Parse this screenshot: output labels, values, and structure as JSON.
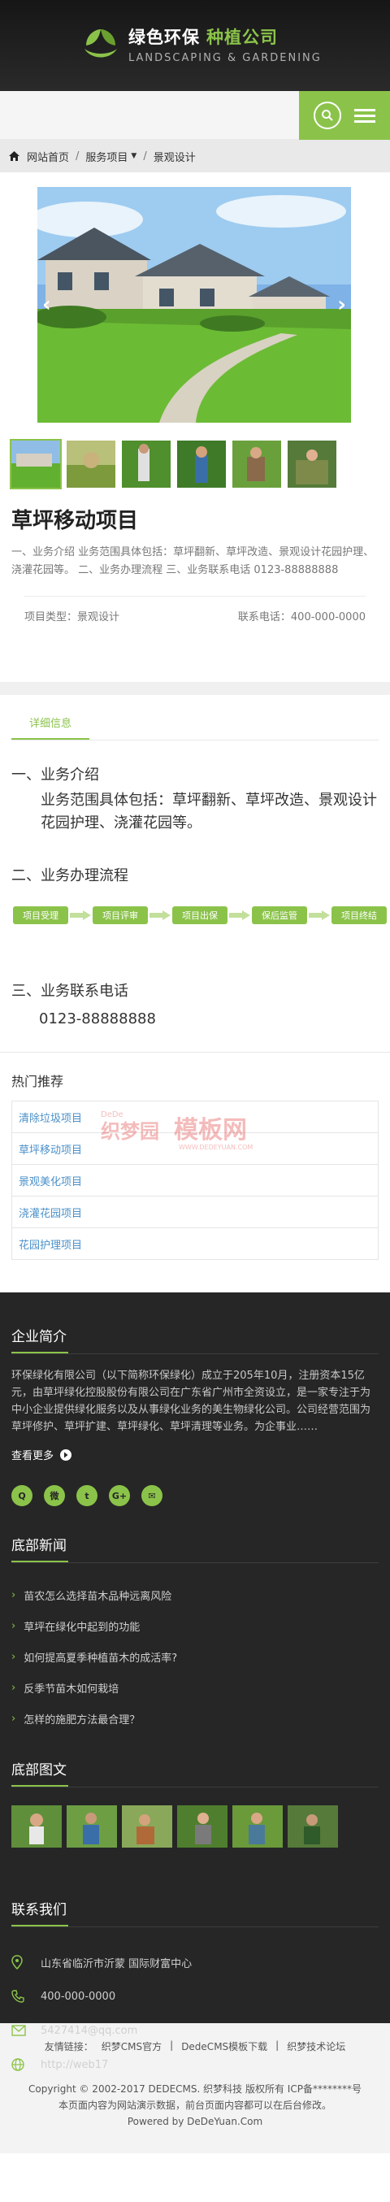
{
  "header": {
    "logo_cn_main": "绿色环保",
    "logo_cn_accent": "种植公司",
    "logo_en": "LANDSCAPING & GARDENING",
    "accent": "#8bc34a"
  },
  "navbar": {
    "search_icon": "search-icon",
    "menu_icon": "menu-icon"
  },
  "breadcrumb": {
    "home": "网站首页",
    "section": "服务项目",
    "current": "景观设计"
  },
  "product": {
    "title": "草坪移动项目",
    "summary": "一、业务介绍 业务范围具体包括：草坪翻新、草坪改造、景观设计花园护理、浇灌花园等。 二、业务办理流程 三、业务联系电话 0123-88888888",
    "type_label": "项目类型：景观设计",
    "phone_label": "联系电话：400-000-0000"
  },
  "detail": {
    "tab": "详细信息",
    "h1": "一、业务介绍",
    "p1": "业务范围具体包括：草坪翻新、草坪改造、景观设计花园护理、浇灌花园等。",
    "h2": "二、业务办理流程",
    "flow": [
      "项目受理",
      "项目评审",
      "项目出保",
      "保后监管",
      "项目终结"
    ],
    "h3": "三、业务联系电话",
    "phone": "0123-88888888"
  },
  "hot": {
    "title": "热门推荐",
    "items": [
      "清除垃圾项目",
      "草坪移动项目",
      "景观美化项目",
      "浇灌花园项目",
      "花园护理项目"
    ]
  },
  "footer": {
    "about_title": "企业简介",
    "about_text": "环保绿化有限公司（以下简称环保绿化）成立于205年10月，注册资本15亿元，由草坪绿化控股股份有限公司在广东省广州市全资设立，是一家专注于为中小企业提供绿化服务以及从事绿化业务的美生物绿化公司。公司经营范围为草坪修护、草坪扩建、草坪绿化、草坪清理等业务。为企事业……",
    "more": "查看更多",
    "news_title": "底部新闻",
    "news": [
      "苗农怎么选择苗木品种远离风险",
      "草坪在绿化中起到的功能",
      "如何提高夏季种植苗木的成活率?",
      "反季节苗木如何栽培",
      "怎样的施肥方法最合理？"
    ],
    "pics_title": "底部图文",
    "contact_title": "联系我们",
    "address": "山东省临沂市沂蒙 国际财富中心",
    "tel": "400-000-0000",
    "email": "5427414@qq.com",
    "web": "http://web17"
  },
  "bottom": {
    "links_label": "友情链接：",
    "links": [
      "织梦CMS官方",
      "DedeCMS模板下载",
      "织梦技术论坛"
    ],
    "copyright": "Copyright © 2002-2017 DEDECMS. 织梦科技 版权所有 ICP备********号",
    "notice": "本页面内容为网站演示数据，前台页面内容都可以在后台修改。",
    "powered": "Powered by DeDeYuan.Com"
  }
}
